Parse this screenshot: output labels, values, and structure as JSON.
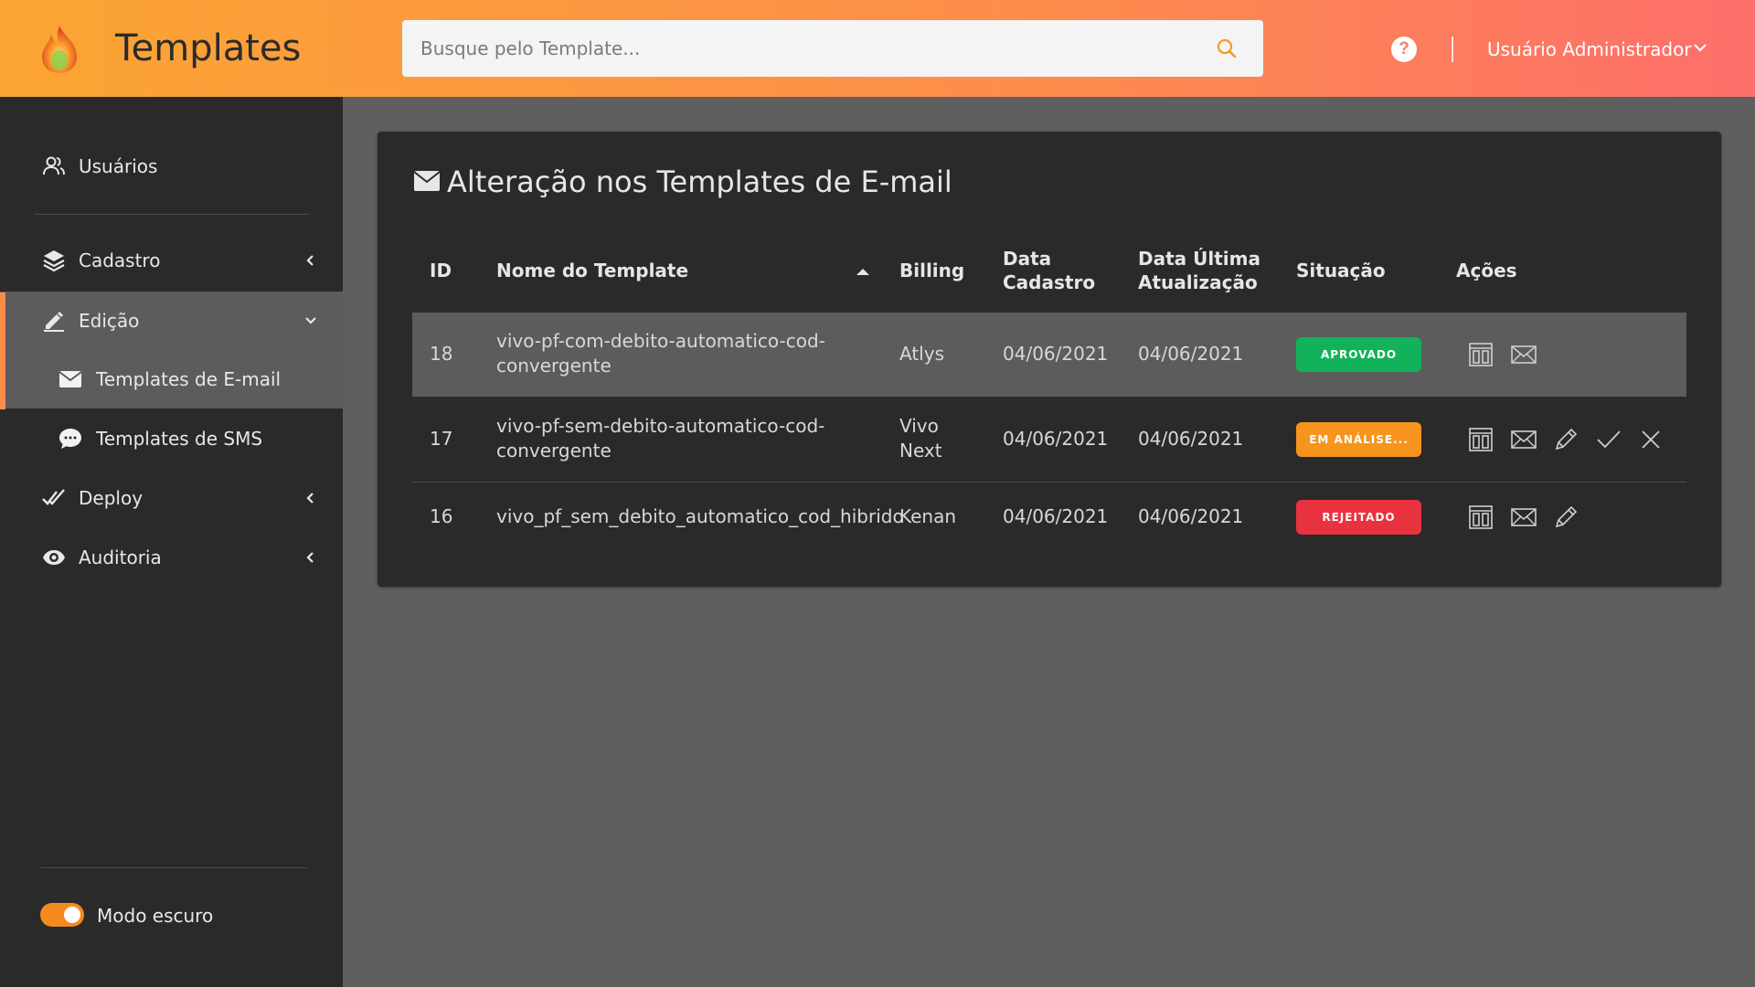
{
  "header": {
    "app_title": "Templates",
    "search_placeholder": "Busque pelo Template...",
    "help_label": "?",
    "user_name": "Usuário Administrador"
  },
  "sidebar": {
    "items": [
      {
        "label": "Usuários",
        "icon": "users-icon"
      },
      {
        "label": "Cadastro",
        "icon": "layers-icon"
      },
      {
        "label": "Edição",
        "icon": "edit-icon"
      },
      {
        "label": "Templates de E-mail",
        "icon": "envelope-icon"
      },
      {
        "label": "Templates de SMS",
        "icon": "chat-icon"
      },
      {
        "label": "Deploy",
        "icon": "double-check-icon"
      },
      {
        "label": "Auditoria",
        "icon": "eye-icon"
      }
    ],
    "dark_mode_label": "Modo escuro",
    "dark_mode_on": true
  },
  "card": {
    "title": "Alteração nos Templates de E-mail",
    "columns": {
      "id": "ID",
      "name": "Nome do Template",
      "billing": "Billing",
      "created_l1": "Data",
      "created_l2": "Cadastro",
      "updated_l1": "Data Última",
      "updated_l2": "Atualização",
      "status": "Situação",
      "actions": "Ações"
    },
    "rows": [
      {
        "id": "18",
        "name_l1": "vivo-pf-com-debito-automatico-cod-",
        "name_l2": "convergente",
        "billing_l1": "Atlys",
        "billing_l2": "",
        "created": "04/06/2021",
        "updated": "04/06/2021",
        "status": "APROVADO",
        "status_color": "#12b25b"
      },
      {
        "id": "17",
        "name_l1": "vivo-pf-sem-debito-automatico-cod-",
        "name_l2": "convergente",
        "billing_l1": "Vivo",
        "billing_l2": "Next",
        "created": "04/06/2021",
        "updated": "04/06/2021",
        "status": "EM ANÁLISE...",
        "status_color": "#f7941d"
      },
      {
        "id": "16",
        "name_l1": "vivo_pf_sem_debito_automatico_cod_hibrido",
        "name_l2": "",
        "billing_l1": "Kenan",
        "billing_l2": "",
        "created": "04/06/2021",
        "updated": "04/06/2021",
        "status": "REJEITADO",
        "status_color": "#e8323f"
      }
    ]
  },
  "colors": {
    "accent": "#fd8c4c",
    "sidebar_bg": "#2a2a2a",
    "selected_bg": "#5c5c5c"
  }
}
